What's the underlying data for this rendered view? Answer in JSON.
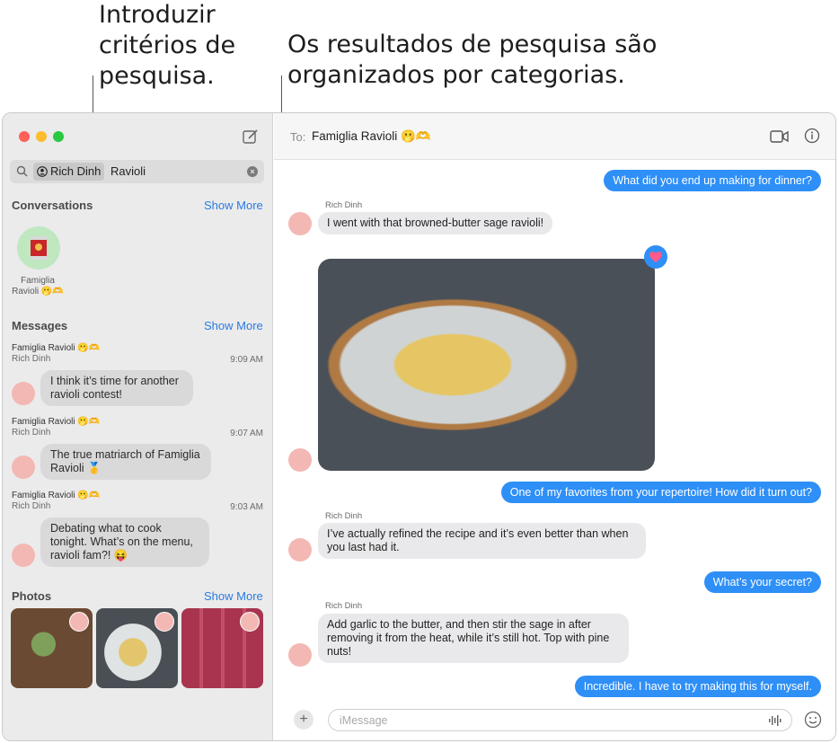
{
  "callouts": {
    "left": "Introduzir\ncritérios de\npesquisa.",
    "right": "Os resultados de pesquisa são\norganizados por categorias."
  },
  "window": {
    "traffic_colors": [
      "#fe5f57",
      "#febc2e",
      "#28c840"
    ]
  },
  "search": {
    "token": "Rich Dinh",
    "text": "Ravioli",
    "clear_icon": "clear-icon"
  },
  "sidebar": {
    "conversations": {
      "title": "Conversations",
      "show_more": "Show More",
      "items": [
        {
          "label": "Famiglia Ravioli 🫢🫶"
        }
      ]
    },
    "messages": {
      "title": "Messages",
      "show_more": "Show More",
      "items": [
        {
          "title": "Famiglia Ravioli 🫢🫶",
          "sender": "Rich Dinh",
          "time": "9:09 AM",
          "text": "I think it’s time for another ravioli contest!"
        },
        {
          "title": "Famiglia Ravioli 🫢🫶",
          "sender": "Rich Dinh",
          "time": "9:07 AM",
          "text": "The true matriarch of Famiglia Ravioli 🥇"
        },
        {
          "title": "Famiglia Ravioli 🫢🫶",
          "sender": "Rich Dinh",
          "time": "9:03 AM",
          "text": "Debating what to cook tonight. What’s on the menu, ravioli fam?! 😝"
        }
      ]
    },
    "photos": {
      "title": "Photos",
      "show_more": "Show More"
    }
  },
  "chat": {
    "to_label": "To:",
    "to_name": "Famiglia Ravioli 🫢🫶",
    "messages": [
      {
        "dir": "out",
        "text": "What did you end up making for dinner?"
      },
      {
        "dir": "in",
        "sender": "Rich Dinh",
        "text": "I went with that browned-butter sage ravioli!"
      },
      {
        "dir": "out",
        "text": "One of my favorites from your repertoire! How did it turn out?"
      },
      {
        "dir": "in",
        "sender": "Rich Dinh",
        "text": "I’ve actually refined the recipe and it’s even better than when you last had it."
      },
      {
        "dir": "out",
        "text": "What’s your secret?"
      },
      {
        "dir": "in",
        "sender": "Rich Dinh",
        "text": "Add garlic to the butter, and then stir the sage in after removing it from the heat, while it’s still hot. Top with pine nuts!"
      },
      {
        "dir": "out",
        "text": "Incredible. I have to try making this for myself."
      }
    ],
    "composer_placeholder": "iMessage",
    "tapback": "heart-icon"
  },
  "colors": {
    "accent": "#2e8ff7",
    "link": "#2a7ae2"
  }
}
